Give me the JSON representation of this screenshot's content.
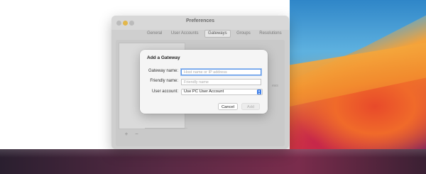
{
  "preferences_window": {
    "title": "Preferences",
    "tabs": [
      {
        "label": "General",
        "active": false
      },
      {
        "label": "User Accounts",
        "active": false
      },
      {
        "label": "Gateways",
        "active": true
      },
      {
        "label": "Groups",
        "active": false
      },
      {
        "label": "Resolutions",
        "active": false
      }
    ],
    "list_footer": {
      "add_label": "+",
      "remove_label": "−"
    },
    "background_fragment": "ews"
  },
  "dialog": {
    "title": "Add a Gateway",
    "gateway_name": {
      "label": "Gateway name:",
      "value": "",
      "placeholder": "Host name or IP address"
    },
    "friendly_name": {
      "label": "Friendly name:",
      "value": "",
      "placeholder": "Friendly name"
    },
    "user_account": {
      "label": "User account:",
      "selected": "Use PC User Account"
    },
    "cancel_label": "Cancel",
    "add_label": "Add"
  },
  "colors": {
    "accent": "#3a7ce8",
    "focus_ring": "#5b95e8",
    "traffic_minimize": "#e2b74b"
  }
}
